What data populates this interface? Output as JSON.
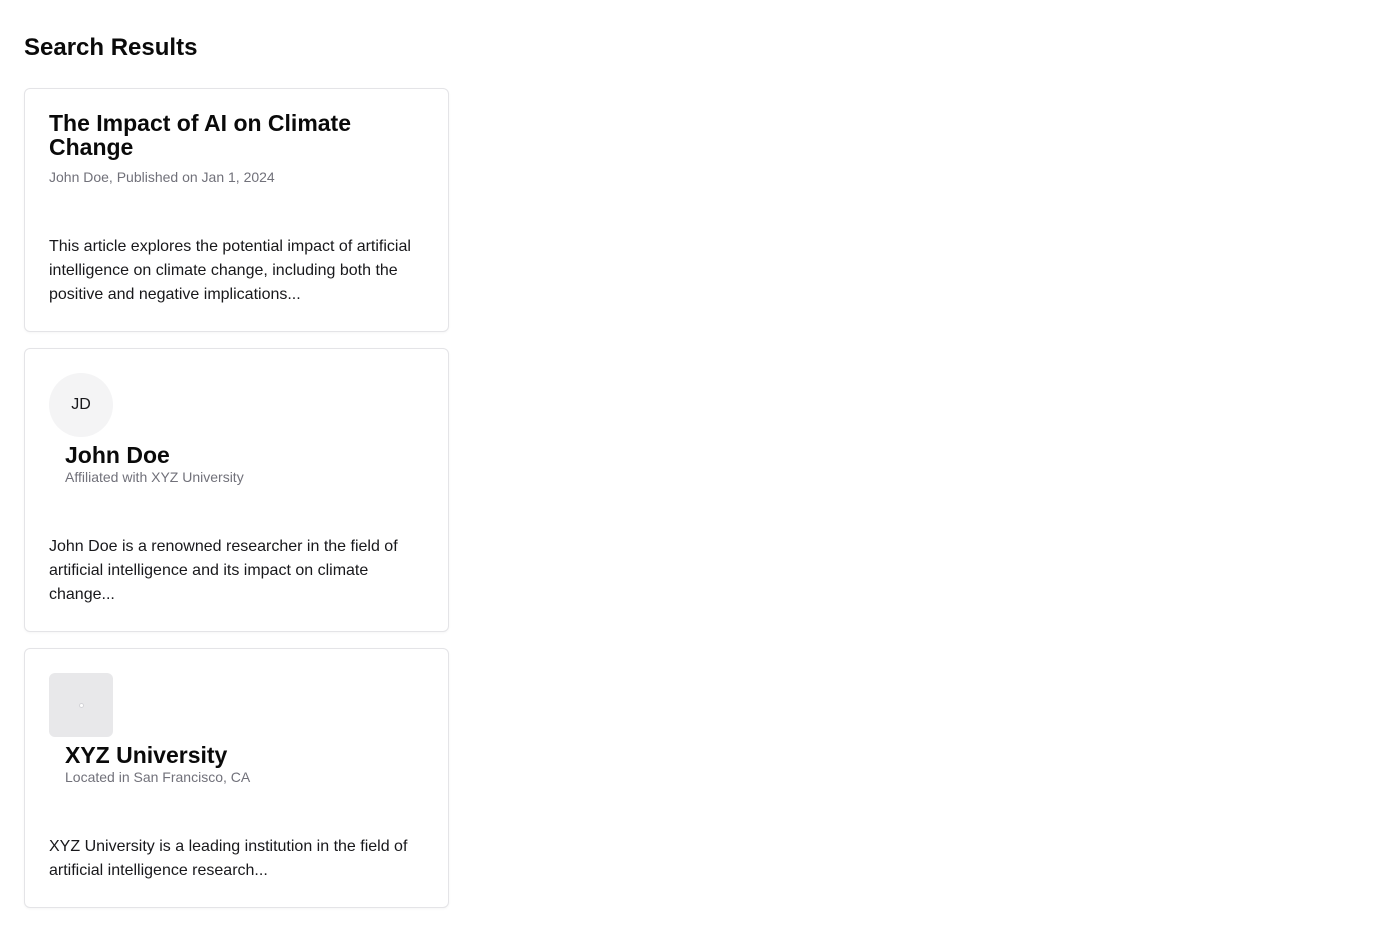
{
  "page": {
    "title": "Search Results"
  },
  "results": {
    "article": {
      "title": "The Impact of AI on Climate Change",
      "meta": "John Doe, Published on Jan 1, 2024",
      "description": "This article explores the potential impact of artificial intelligence on climate change, including both the positive and negative implications..."
    },
    "person": {
      "initials": "JD",
      "name": "John Doe",
      "meta": "Affiliated with XYZ University",
      "description": "John Doe is a renowned researcher in the field of artificial intelligence and its impact on climate change..."
    },
    "institution": {
      "name": "XYZ University",
      "meta": "Located in San Francisco, CA",
      "description": "XYZ University is a leading institution in the field of artificial intelligence research..."
    }
  }
}
